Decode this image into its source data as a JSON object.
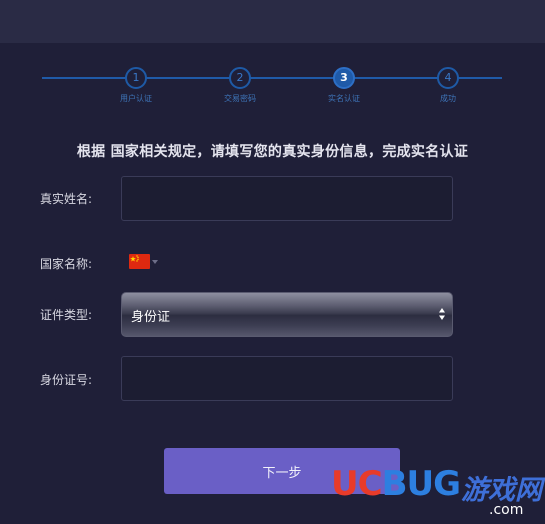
{
  "stepper": {
    "steps": [
      {
        "number": "1",
        "label": "用户认证",
        "state": "done"
      },
      {
        "number": "2",
        "label": "交易密码",
        "state": "done"
      },
      {
        "number": "3",
        "label": "实名认证",
        "state": "active"
      },
      {
        "number": "4",
        "label": "成功",
        "state": "pending"
      }
    ]
  },
  "notice": "根据 国家相关规定，请填写您的真实身份信息，完成实名认证",
  "form": {
    "real_name_label": "真实姓名:",
    "real_name_value": "",
    "country_label": "国家名称:",
    "country_flag": "china-flag-icon",
    "id_type_label": "证件类型:",
    "id_type_value": "身份证",
    "id_number_label": "身份证号:",
    "id_number_value": ""
  },
  "next_button": "下一步",
  "watermark": {
    "uc": "UC",
    "bug": "BUG",
    "cn": "游戏网",
    "suffix": ".com"
  },
  "colors": {
    "background": "#1f1f38",
    "accent": "#1f5aa8",
    "button": "#6a5fc6"
  }
}
